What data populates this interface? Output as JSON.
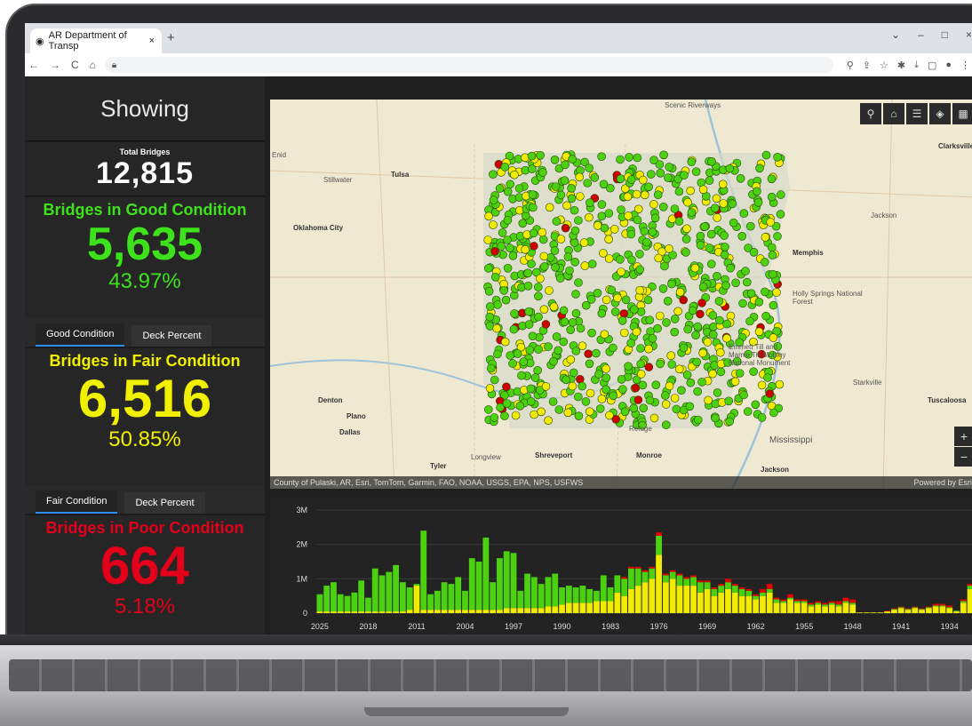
{
  "browser": {
    "tab_title": "AR Department of Transp",
    "tab_close": "×",
    "new_tab": "+",
    "window_controls": [
      "⌄",
      "–",
      "□",
      "×"
    ],
    "nav_icons": [
      "←",
      "→",
      "C",
      "⌂"
    ],
    "toolbar_icons": [
      "⚲",
      "⇪",
      "☆",
      "✱",
      "⤓",
      "▢",
      "●",
      "⋮"
    ]
  },
  "sidebar": {
    "showing": "Showing",
    "total_label": "Total Bridges",
    "total_value": "12,815",
    "good": {
      "title": "Bridges in Good Condition",
      "value": "5,635",
      "percent": "43.97%",
      "tabs": [
        "Good Condition",
        "Deck Percent"
      ]
    },
    "fair": {
      "title": "Bridges in Fair Condition",
      "value": "6,516",
      "percent": "50.85%",
      "tabs": [
        "Fair Condition",
        "Deck Percent"
      ]
    },
    "poor": {
      "title": "Bridges in Poor Condition",
      "value": "664",
      "percent": "5.18%"
    }
  },
  "map": {
    "attribution": "County of Pulaski, AR, Esri, TomTom, Garmin, FAO, NOAA, USGS, EPA, NPS, USFWS",
    "powered": "Powered by Esri",
    "tools": [
      "search-icon",
      "home-icon",
      "legend-icon",
      "layers-icon",
      "qr-icon"
    ],
    "tool_glyphs": [
      "⚲",
      "⌂",
      "☰",
      "◈",
      "▦"
    ],
    "zoom_in": "+",
    "zoom_out": "−",
    "labels": {
      "scenic": "Scenic Riverways",
      "enid": "Enid",
      "stillwater": "Stillwater",
      "tulsa": "Tulsa",
      "okc": "Oklahoma City",
      "memphis": "Memphis",
      "clarksville": "Clarksville",
      "jackson_tn": "Jackson",
      "holly": "Holly Springs National Forest",
      "emmett": "Emmett Till and Mamie Till-Mobley National Monument",
      "starkville": "Starkville",
      "tuscaloosa": "Tuscaloosa",
      "denton": "Denton",
      "plano": "Plano",
      "dallas": "Dallas",
      "tyler": "Tyler",
      "longview": "Longview",
      "shreveport": "Shreveport",
      "monroe": "Monroe",
      "mississippi": "Mississippi",
      "jackson_ms": "Jackson",
      "refuge": "Refuge"
    },
    "colors": {
      "good": "#4bd10f",
      "fair": "#f2ea00",
      "poor": "#cc0000"
    }
  },
  "chart_data": {
    "type": "bar",
    "stacked": true,
    "ylim": [
      0,
      3000000
    ],
    "yticks": [
      "0",
      "1M",
      "2M",
      "3M"
    ],
    "xticks": [
      "2025",
      "2018",
      "2011",
      "2004",
      "1997",
      "1990",
      "1983",
      "1976",
      "1969",
      "1962",
      "1955",
      "1948",
      "1941",
      "1934"
    ],
    "series": [
      {
        "name": "",
        "color": "#f2ea00"
      },
      {
        "name": "",
        "color": "#4bd10f"
      },
      {
        "name": "",
        "color": "#e40000"
      }
    ],
    "bars": [
      {
        "x": 2025,
        "fair": 0.05,
        "good": 0.5,
        "poor": 0
      },
      {
        "x": 2024,
        "fair": 0.05,
        "good": 0.75,
        "poor": 0
      },
      {
        "x": 2023,
        "fair": 0.05,
        "good": 0.85,
        "poor": 0
      },
      {
        "x": 2022,
        "fair": 0.05,
        "good": 0.5,
        "poor": 0
      },
      {
        "x": 2021,
        "fair": 0.05,
        "good": 0.45,
        "poor": 0
      },
      {
        "x": 2020,
        "fair": 0.05,
        "good": 0.55,
        "poor": 0
      },
      {
        "x": 2019,
        "fair": 0.05,
        "good": 0.9,
        "poor": 0
      },
      {
        "x": 2018,
        "fair": 0.05,
        "good": 0.4,
        "poor": 0
      },
      {
        "x": 2017,
        "fair": 0.05,
        "good": 1.25,
        "poor": 0
      },
      {
        "x": 2016,
        "fair": 0.05,
        "good": 1.05,
        "poor": 0
      },
      {
        "x": 2015,
        "fair": 0.05,
        "good": 1.15,
        "poor": 0
      },
      {
        "x": 2014,
        "fair": 0.05,
        "good": 1.35,
        "poor": 0
      },
      {
        "x": 2013,
        "fair": 0.05,
        "good": 0.85,
        "poor": 0
      },
      {
        "x": 2012,
        "fair": 0.1,
        "good": 0.65,
        "poor": 0
      },
      {
        "x": 2011,
        "fair": 0.8,
        "good": 0.05,
        "poor": 0
      },
      {
        "x": 2010,
        "fair": 0.1,
        "good": 2.3,
        "poor": 0
      },
      {
        "x": 2009,
        "fair": 0.1,
        "good": 0.45,
        "poor": 0
      },
      {
        "x": 2008,
        "fair": 0.1,
        "good": 0.55,
        "poor": 0
      },
      {
        "x": 2007,
        "fair": 0.1,
        "good": 0.8,
        "poor": 0
      },
      {
        "x": 2006,
        "fair": 0.1,
        "good": 0.75,
        "poor": 0
      },
      {
        "x": 2005,
        "fair": 0.1,
        "good": 0.95,
        "poor": 0
      },
      {
        "x": 2004,
        "fair": 0.1,
        "good": 0.55,
        "poor": 0
      },
      {
        "x": 2003,
        "fair": 0.1,
        "good": 1.5,
        "poor": 0
      },
      {
        "x": 2002,
        "fair": 0.1,
        "good": 1.4,
        "poor": 0
      },
      {
        "x": 2001,
        "fair": 0.1,
        "good": 2.1,
        "poor": 0
      },
      {
        "x": 2000,
        "fair": 0.1,
        "good": 0.8,
        "poor": 0
      },
      {
        "x": 1999,
        "fair": 0.1,
        "good": 1.5,
        "poor": 0
      },
      {
        "x": 1998,
        "fair": 0.15,
        "good": 1.65,
        "poor": 0
      },
      {
        "x": 1997,
        "fair": 0.15,
        "good": 1.6,
        "poor": 0
      },
      {
        "x": 1996,
        "fair": 0.15,
        "good": 0.5,
        "poor": 0
      },
      {
        "x": 1995,
        "fair": 0.15,
        "good": 1.0,
        "poor": 0
      },
      {
        "x": 1994,
        "fair": 0.15,
        "good": 0.9,
        "poor": 0
      },
      {
        "x": 1993,
        "fair": 0.15,
        "good": 0.7,
        "poor": 0
      },
      {
        "x": 1992,
        "fair": 0.2,
        "good": 0.85,
        "poor": 0
      },
      {
        "x": 1991,
        "fair": 0.2,
        "good": 0.95,
        "poor": 0
      },
      {
        "x": 1990,
        "fair": 0.25,
        "good": 0.5,
        "poor": 0
      },
      {
        "x": 1989,
        "fair": 0.3,
        "good": 0.5,
        "poor": 0
      },
      {
        "x": 1988,
        "fair": 0.3,
        "good": 0.45,
        "poor": 0
      },
      {
        "x": 1987,
        "fair": 0.3,
        "good": 0.5,
        "poor": 0
      },
      {
        "x": 1986,
        "fair": 0.3,
        "good": 0.4,
        "poor": 0
      },
      {
        "x": 1985,
        "fair": 0.35,
        "good": 0.3,
        "poor": 0
      },
      {
        "x": 1984,
        "fair": 0.35,
        "good": 0.75,
        "poor": 0
      },
      {
        "x": 1983,
        "fair": 0.35,
        "good": 0.4,
        "poor": 0
      },
      {
        "x": 1982,
        "fair": 0.6,
        "good": 0.5,
        "poor": 0
      },
      {
        "x": 1981,
        "fair": 0.5,
        "good": 0.5,
        "poor": 0.05
      },
      {
        "x": 1980,
        "fair": 0.7,
        "good": 0.6,
        "poor": 0.05
      },
      {
        "x": 1979,
        "fair": 0.8,
        "good": 0.5,
        "poor": 0.05
      },
      {
        "x": 1978,
        "fair": 0.9,
        "good": 0.3,
        "poor": 0.05
      },
      {
        "x": 1977,
        "fair": 1.0,
        "good": 0.3,
        "poor": 0.05
      },
      {
        "x": 1976,
        "fair": 1.7,
        "good": 0.55,
        "poor": 0.1
      },
      {
        "x": 1975,
        "fair": 0.9,
        "good": 0.2,
        "poor": 0.05
      },
      {
        "x": 1974,
        "fair": 1.0,
        "good": 0.2,
        "poor": 0.05
      },
      {
        "x": 1973,
        "fair": 0.8,
        "good": 0.3,
        "poor": 0.05
      },
      {
        "x": 1972,
        "fair": 0.8,
        "good": 0.2,
        "poor": 0.05
      },
      {
        "x": 1971,
        "fair": 0.8,
        "good": 0.25,
        "poor": 0.05
      },
      {
        "x": 1970,
        "fair": 0.6,
        "good": 0.3,
        "poor": 0.05
      },
      {
        "x": 1969,
        "fair": 0.7,
        "good": 0.2,
        "poor": 0.05
      },
      {
        "x": 1968,
        "fair": 0.5,
        "good": 0.2,
        "poor": 0.05
      },
      {
        "x": 1967,
        "fair": 0.6,
        "good": 0.2,
        "poor": 0.05
      },
      {
        "x": 1966,
        "fair": 0.7,
        "good": 0.2,
        "poor": 0.1
      },
      {
        "x": 1965,
        "fair": 0.6,
        "good": 0.2,
        "poor": 0.05
      },
      {
        "x": 1964,
        "fair": 0.5,
        "good": 0.2,
        "poor": 0.05
      },
      {
        "x": 1963,
        "fair": 0.5,
        "good": 0.15,
        "poor": 0.05
      },
      {
        "x": 1962,
        "fair": 0.4,
        "good": 0.1,
        "poor": 0.05
      },
      {
        "x": 1961,
        "fair": 0.5,
        "good": 0.1,
        "poor": 0.1
      },
      {
        "x": 1960,
        "fair": 0.6,
        "good": 0.1,
        "poor": 0.15
      },
      {
        "x": 1959,
        "fair": 0.3,
        "good": 0.1,
        "poor": 0.05
      },
      {
        "x": 1958,
        "fair": 0.3,
        "good": 0.05,
        "poor": 0.05
      },
      {
        "x": 1957,
        "fair": 0.4,
        "good": 0.05,
        "poor": 0.1
      },
      {
        "x": 1956,
        "fair": 0.3,
        "good": 0.05,
        "poor": 0.05
      },
      {
        "x": 1955,
        "fair": 0.3,
        "good": 0.05,
        "poor": 0.05
      },
      {
        "x": 1954,
        "fair": 0.2,
        "good": 0.05,
        "poor": 0.05
      },
      {
        "x": 1953,
        "fair": 0.25,
        "good": 0.05,
        "poor": 0.05
      },
      {
        "x": 1952,
        "fair": 0.2,
        "good": 0.05,
        "poor": 0.05
      },
      {
        "x": 1951,
        "fair": 0.25,
        "good": 0.05,
        "poor": 0.05
      },
      {
        "x": 1950,
        "fair": 0.2,
        "good": 0.05,
        "poor": 0.1
      },
      {
        "x": 1949,
        "fair": 0.3,
        "good": 0.05,
        "poor": 0.1
      },
      {
        "x": 1948,
        "fair": 0.25,
        "good": 0.05,
        "poor": 0.1
      },
      {
        "x": 1947,
        "fair": 0.02,
        "good": 0.0,
        "poor": 0.0
      },
      {
        "x": 1946,
        "fair": 0.02,
        "good": 0.0,
        "poor": 0.0
      },
      {
        "x": 1945,
        "fair": 0.02,
        "good": 0.0,
        "poor": 0.0
      },
      {
        "x": 1944,
        "fair": 0.02,
        "good": 0.0,
        "poor": 0.0
      },
      {
        "x": 1943,
        "fair": 0.05,
        "good": 0.0,
        "poor": 0.02
      },
      {
        "x": 1942,
        "fair": 0.1,
        "good": 0.02,
        "poor": 0.02
      },
      {
        "x": 1941,
        "fair": 0.15,
        "good": 0.02,
        "poor": 0.02
      },
      {
        "x": 1940,
        "fair": 0.1,
        "good": 0.02,
        "poor": 0.02
      },
      {
        "x": 1939,
        "fair": 0.15,
        "good": 0.02,
        "poor": 0.02
      },
      {
        "x": 1938,
        "fair": 0.1,
        "good": 0.02,
        "poor": 0.02
      },
      {
        "x": 1937,
        "fair": 0.15,
        "good": 0.02,
        "poor": 0.02
      },
      {
        "x": 1936,
        "fair": 0.2,
        "good": 0.02,
        "poor": 0.05
      },
      {
        "x": 1935,
        "fair": 0.2,
        "good": 0.02,
        "poor": 0.05
      },
      {
        "x": 1934,
        "fair": 0.15,
        "good": 0.02,
        "poor": 0.05
      },
      {
        "x": 1933,
        "fair": 0.05,
        "good": 0.02,
        "poor": 0.0
      },
      {
        "x": 1932,
        "fair": 0.3,
        "good": 0.05,
        "poor": 0.05
      },
      {
        "x": 1931,
        "fair": 0.7,
        "good": 0.1,
        "poor": 0.05
      }
    ]
  }
}
